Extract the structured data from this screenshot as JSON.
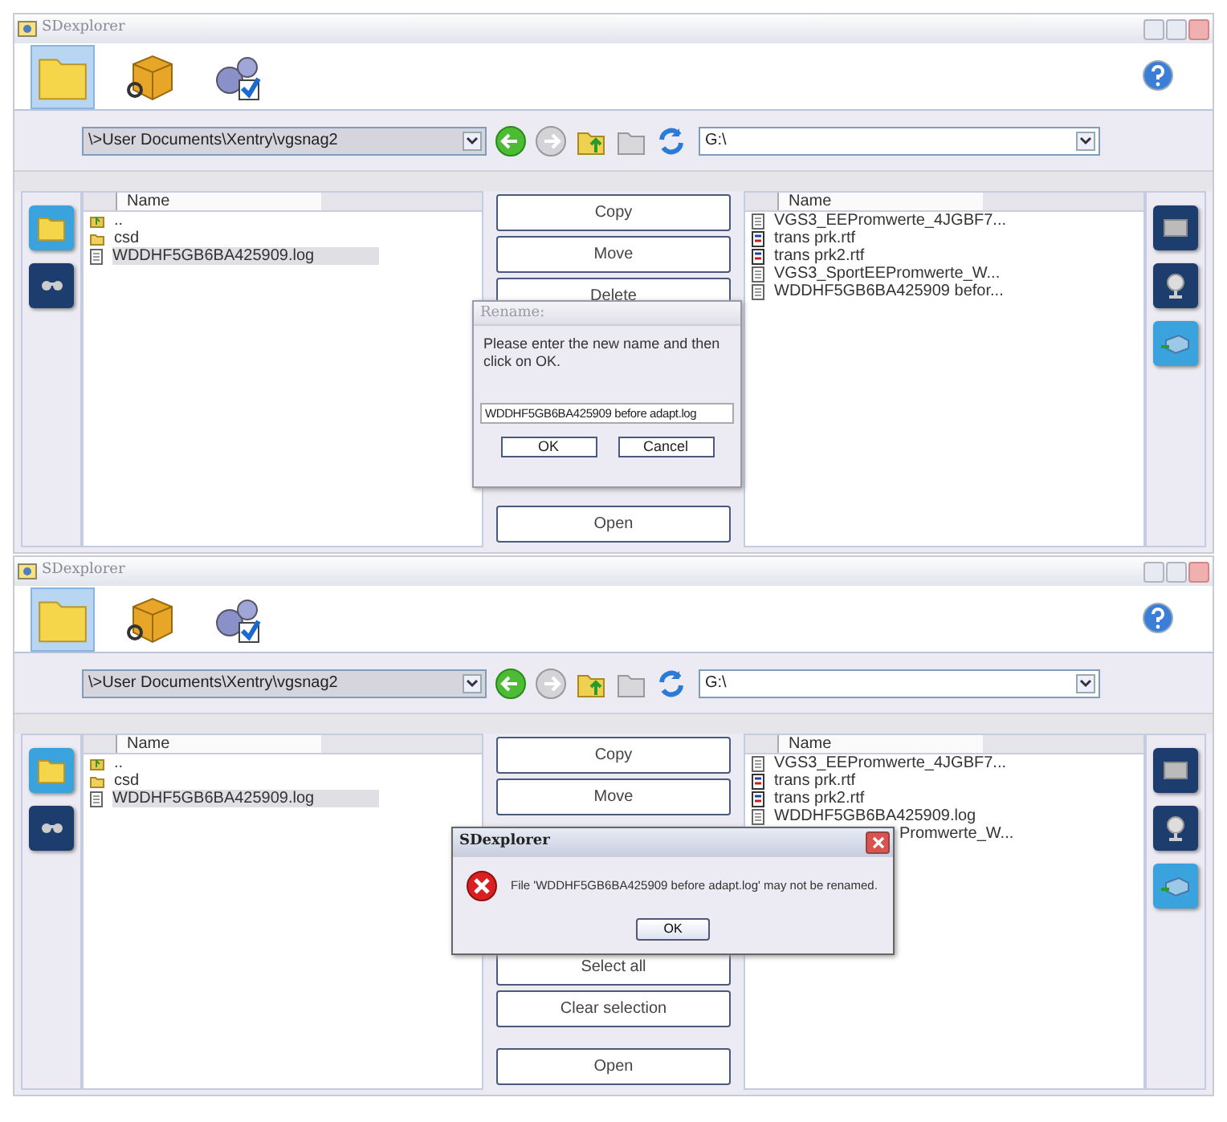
{
  "screens": [
    {
      "window": {
        "title": "SDexplorer"
      },
      "tools": [
        {
          "kind": "folder",
          "selected": true
        },
        {
          "kind": "cube",
          "selected": false
        },
        {
          "kind": "gears",
          "selected": false
        }
      ],
      "path_bar": {
        "left_path": "\\>User Documents\\Xentry\\vgsnag2",
        "right_path": "G:\\"
      },
      "left_side_buttons": [
        {
          "kind": "folder",
          "selected": true
        },
        {
          "kind": "binoculars",
          "selected": false
        }
      ],
      "left_list": {
        "column": "Name",
        "items": [
          {
            "name": "..",
            "kind": "parent",
            "selected": false
          },
          {
            "name": "csd",
            "kind": "folder",
            "selected": false
          },
          {
            "name": "WDDHF5GB6BA425909.log",
            "kind": "doc",
            "selected": true
          }
        ]
      },
      "actions": {
        "top": [
          "Copy",
          "Move",
          "Delete"
        ],
        "bottom": [
          "Open"
        ]
      },
      "right_list": {
        "column": "Name",
        "items": [
          {
            "name": "VGS3_EEPromwerte_4JGBF7...",
            "kind": "doc"
          },
          {
            "name": "trans prk.rtf",
            "kind": "rtf"
          },
          {
            "name": "trans prk2.rtf",
            "kind": "rtf"
          },
          {
            "name": "VGS3_SportEEPromwerte_W...",
            "kind": "doc"
          },
          {
            "name": "WDDHF5GB6BA425909 befor...",
            "kind": "doc"
          }
        ]
      },
      "right_side_buttons": [
        {
          "kind": "monitor",
          "selected": false
        },
        {
          "kind": "globe",
          "selected": false
        },
        {
          "kind": "drive",
          "selected": true
        }
      ],
      "dialog": {
        "kind": "rename",
        "title": "Rename:",
        "message": "Please enter the new name and then click on OK.",
        "value": "WDDHF5GB6BA425909 before adapt.log",
        "buttons": [
          "OK",
          "Cancel"
        ]
      }
    },
    {
      "window": {
        "title": "SDexplorer"
      },
      "tools": [
        {
          "kind": "folder",
          "selected": true
        },
        {
          "kind": "cube",
          "selected": false
        },
        {
          "kind": "gears",
          "selected": false
        }
      ],
      "path_bar": {
        "left_path": "\\>User Documents\\Xentry\\vgsnag2",
        "right_path": "G:\\"
      },
      "left_side_buttons": [
        {
          "kind": "folder",
          "selected": true
        },
        {
          "kind": "binoculars",
          "selected": false
        }
      ],
      "left_list": {
        "column": "Name",
        "items": [
          {
            "name": "..",
            "kind": "parent",
            "selected": false
          },
          {
            "name": "csd",
            "kind": "folder",
            "selected": false
          },
          {
            "name": "WDDHF5GB6BA425909.log",
            "kind": "doc",
            "selected": true
          }
        ]
      },
      "actions": {
        "top": [
          "Copy",
          "Move"
        ],
        "bottom": [
          "Select all",
          "Clear selection",
          "Open"
        ]
      },
      "right_list": {
        "column": "Name",
        "items": [
          {
            "name": "VGS3_EEPromwerte_4JGBF7...",
            "kind": "doc"
          },
          {
            "name": "trans prk.rtf",
            "kind": "rtf"
          },
          {
            "name": "trans prk2.rtf",
            "kind": "rtf"
          },
          {
            "name": "WDDHF5GB6BA425909.log",
            "kind": "doc"
          },
          {
            "name": "Promwerte_W...",
            "kind": "clipped"
          }
        ]
      },
      "right_side_buttons": [
        {
          "kind": "monitor",
          "selected": false
        },
        {
          "kind": "globe",
          "selected": false
        },
        {
          "kind": "drive",
          "selected": true
        }
      ],
      "dialog": {
        "kind": "error",
        "title": "SDexplorer",
        "message": "File 'WDDHF5GB6BA425909 before adapt.log' may not be renamed.",
        "buttons": [
          "OK"
        ]
      }
    }
  ]
}
